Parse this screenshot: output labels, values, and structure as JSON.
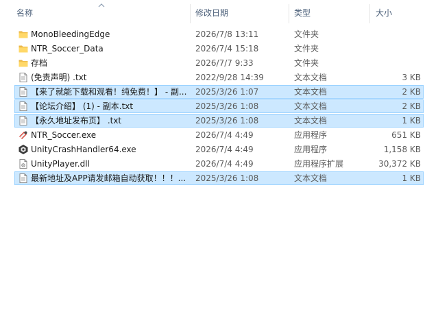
{
  "columns": {
    "name": "名称",
    "date": "修改日期",
    "type": "类型",
    "size": "大小"
  },
  "files": [
    {
      "name": "MonoBleedingEdge",
      "date": "2026/7/8 13:11",
      "type": "文件夹",
      "size": "",
      "icon": "folder-icon",
      "selected": false
    },
    {
      "name": "NTR_Soccer_Data",
      "date": "2026/7/4 15:18",
      "type": "文件夹",
      "size": "",
      "icon": "folder-icon",
      "selected": false
    },
    {
      "name": "存档",
      "date": "2026/7/7 9:33",
      "type": "文件夹",
      "size": "",
      "icon": "folder-icon",
      "selected": false
    },
    {
      "name": "(免责声明) .txt",
      "date": "2022/9/28 14:39",
      "type": "文本文档",
      "size": "3 KB",
      "icon": "text-file-icon",
      "selected": false
    },
    {
      "name": "【来了就能下载和观看！纯免费！】 - 副...",
      "date": "2025/3/26 1:07",
      "type": "文本文档",
      "size": "2 KB",
      "icon": "text-file-icon",
      "selected": true
    },
    {
      "name": "【论坛介绍】 (1) - 副本.txt",
      "date": "2025/3/26 1:08",
      "type": "文本文档",
      "size": "2 KB",
      "icon": "text-file-icon",
      "selected": true
    },
    {
      "name": "【永久地址发布页】 .txt",
      "date": "2025/3/26 1:08",
      "type": "文本文档",
      "size": "1 KB",
      "icon": "text-file-icon",
      "selected": true
    },
    {
      "name": "NTR_Soccer.exe",
      "date": "2026/7/4 4:49",
      "type": "应用程序",
      "size": "651 KB",
      "icon": "game-exe-icon",
      "selected": false
    },
    {
      "name": "UnityCrashHandler64.exe",
      "date": "2026/7/4 4:49",
      "type": "应用程序",
      "size": "1,158 KB",
      "icon": "unity-exe-icon",
      "selected": false
    },
    {
      "name": "UnityPlayer.dll",
      "date": "2026/7/4 4:49",
      "type": "应用程序扩展",
      "size": "30,372 KB",
      "icon": "dll-file-icon",
      "selected": false
    },
    {
      "name": "最新地址及APP请发邮箱自动获取！！！...",
      "date": "2025/3/26 1:08",
      "type": "文本文档",
      "size": "1 KB",
      "icon": "text-file-icon",
      "selected": true
    }
  ]
}
